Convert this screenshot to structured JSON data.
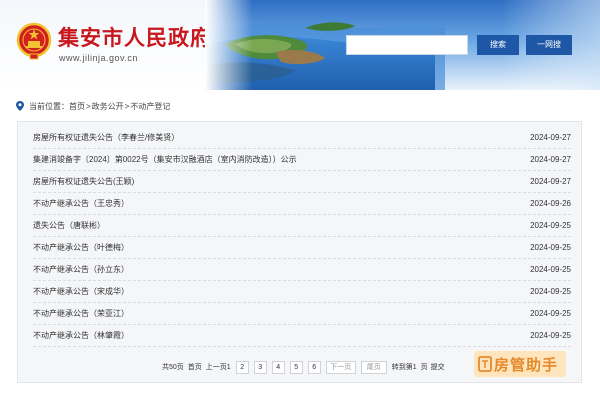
{
  "header": {
    "site_title": "集安市人民政府",
    "site_url": "www.jilinja.gov.cn",
    "search": {
      "value": "",
      "placeholder": ""
    },
    "search_button": "搜索",
    "one_ask_button": "一网搜"
  },
  "breadcrumb": {
    "prefix": "当前位置：",
    "items": [
      "首页",
      "政务公开",
      "不动产登记"
    ],
    "separator": ">"
  },
  "list": {
    "items": [
      {
        "title": "房屋所有权证遗失公告（李春兰/修美贤）",
        "date": "2024-09-27"
      },
      {
        "title": "集建消竣备字〔2024〕第0022号（集安市汉融酒店（室内消防改造））公示",
        "date": "2024-09-27"
      },
      {
        "title": "房屋所有权证遗失公告(王颖)",
        "date": "2024-09-27"
      },
      {
        "title": "不动产继承公告（王忠秀）",
        "date": "2024-09-26"
      },
      {
        "title": "遗失公告（唐联彬）",
        "date": "2024-09-25"
      },
      {
        "title": "不动产继承公告（叶德梅）",
        "date": "2024-09-25"
      },
      {
        "title": "不动产继承公告（孙立东）",
        "date": "2024-09-25"
      },
      {
        "title": "不动产继承公告（宋成华）",
        "date": "2024-09-25"
      },
      {
        "title": "不动产继承公告（荣亚江）",
        "date": "2024-09-25"
      },
      {
        "title": "不动产继承公告（林肇霞）",
        "date": "2024-09-25"
      }
    ]
  },
  "pagination": {
    "total_text": "共50页",
    "first": "首页",
    "prev": "上一页",
    "current": "1",
    "pages": [
      "2",
      "3",
      "4",
      "5",
      "6"
    ],
    "next": "下一页",
    "last": "尾页",
    "jump_prefix": "转到第",
    "jump_value": "1",
    "jump_suffix": "页",
    "submit": "提交"
  },
  "watermark": {
    "text": "房管助手"
  },
  "colors": {
    "title_red": "#c8161d",
    "button_blue": "#1d57a6",
    "panel_bg": "#f5f6f8",
    "watermark_orange": "#e58a2b"
  }
}
